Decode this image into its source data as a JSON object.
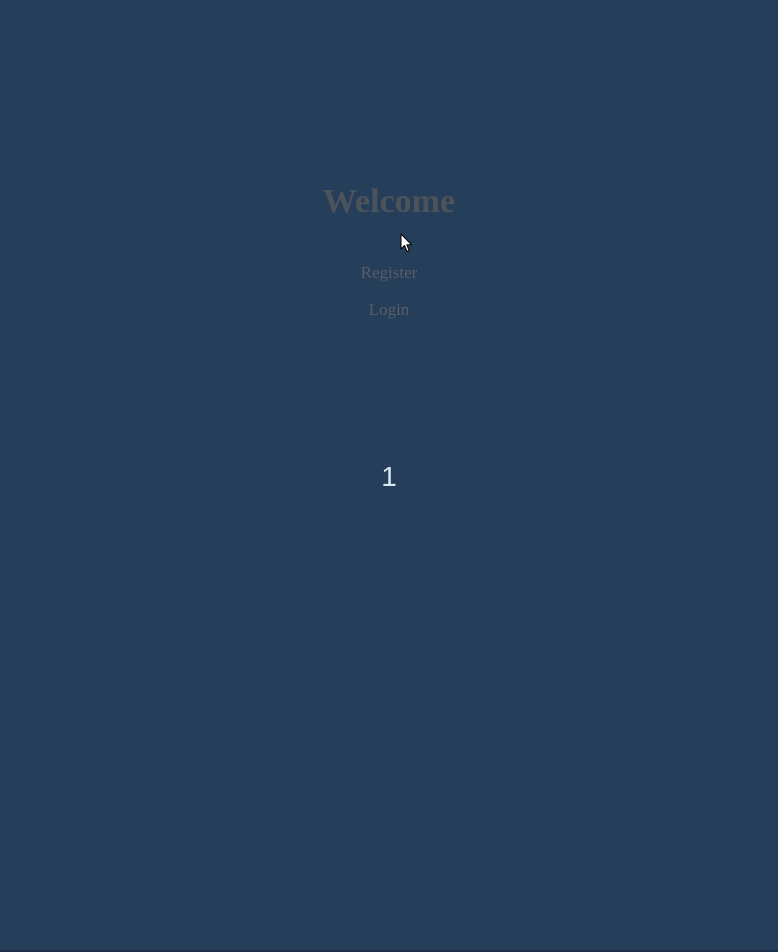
{
  "welcome": {
    "title": "Welcome",
    "register_label": "Register",
    "login_label": "Login"
  },
  "counter": {
    "value": "1"
  },
  "colors": {
    "background": "#253e5a",
    "title": "#4d535b",
    "links": "#595e66",
    "counter": "#d8e6f2"
  },
  "icons": {
    "cursor": "mouse-pointer-icon"
  }
}
